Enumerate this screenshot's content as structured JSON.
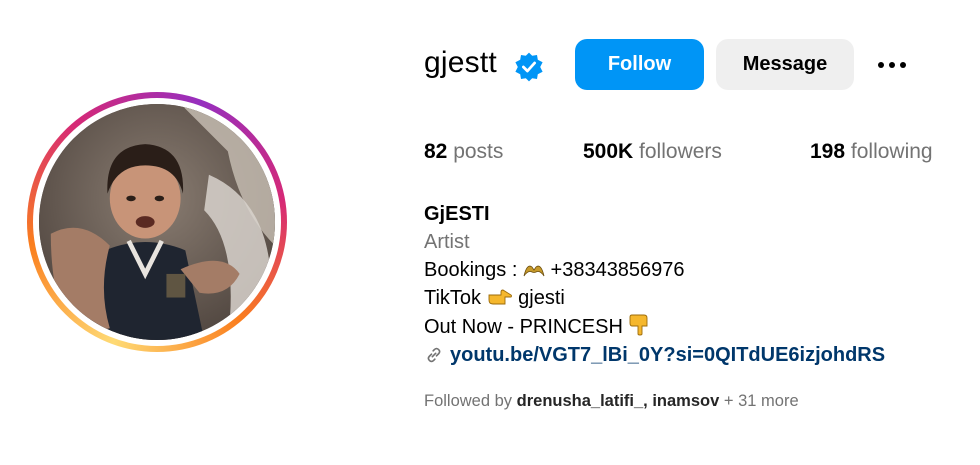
{
  "profile": {
    "username": "gjestt",
    "verified_icon": "verified-badge-icon",
    "follow_label": "Follow",
    "message_label": "Message",
    "more_icon": "more-options-icon"
  },
  "stats": {
    "posts_count": "82",
    "posts_label": "posts",
    "followers_count": "500K",
    "followers_label": "followers",
    "following_count": "198",
    "following_label": "following"
  },
  "bio": {
    "name": "GjESTI",
    "category": "Artist",
    "line1": "Bookings : ",
    "line1_value": "+38343856976",
    "line2": "TikTok ",
    "line2_value": "gjesti",
    "line3": "Out Now - PRINCESH ",
    "link": "youtu.be/VGT7_lBi_0Y?si=0QITdUE6izjohdRS"
  },
  "followed_by": {
    "prefix": "Followed by ",
    "users": "drenusha_latifi_, inamsov",
    "suffix": " + 31 more"
  },
  "colors": {
    "follow_blue": "#0095f6",
    "link_blue": "#00376b",
    "muted_gray": "#737373",
    "message_bg": "#efefef"
  }
}
